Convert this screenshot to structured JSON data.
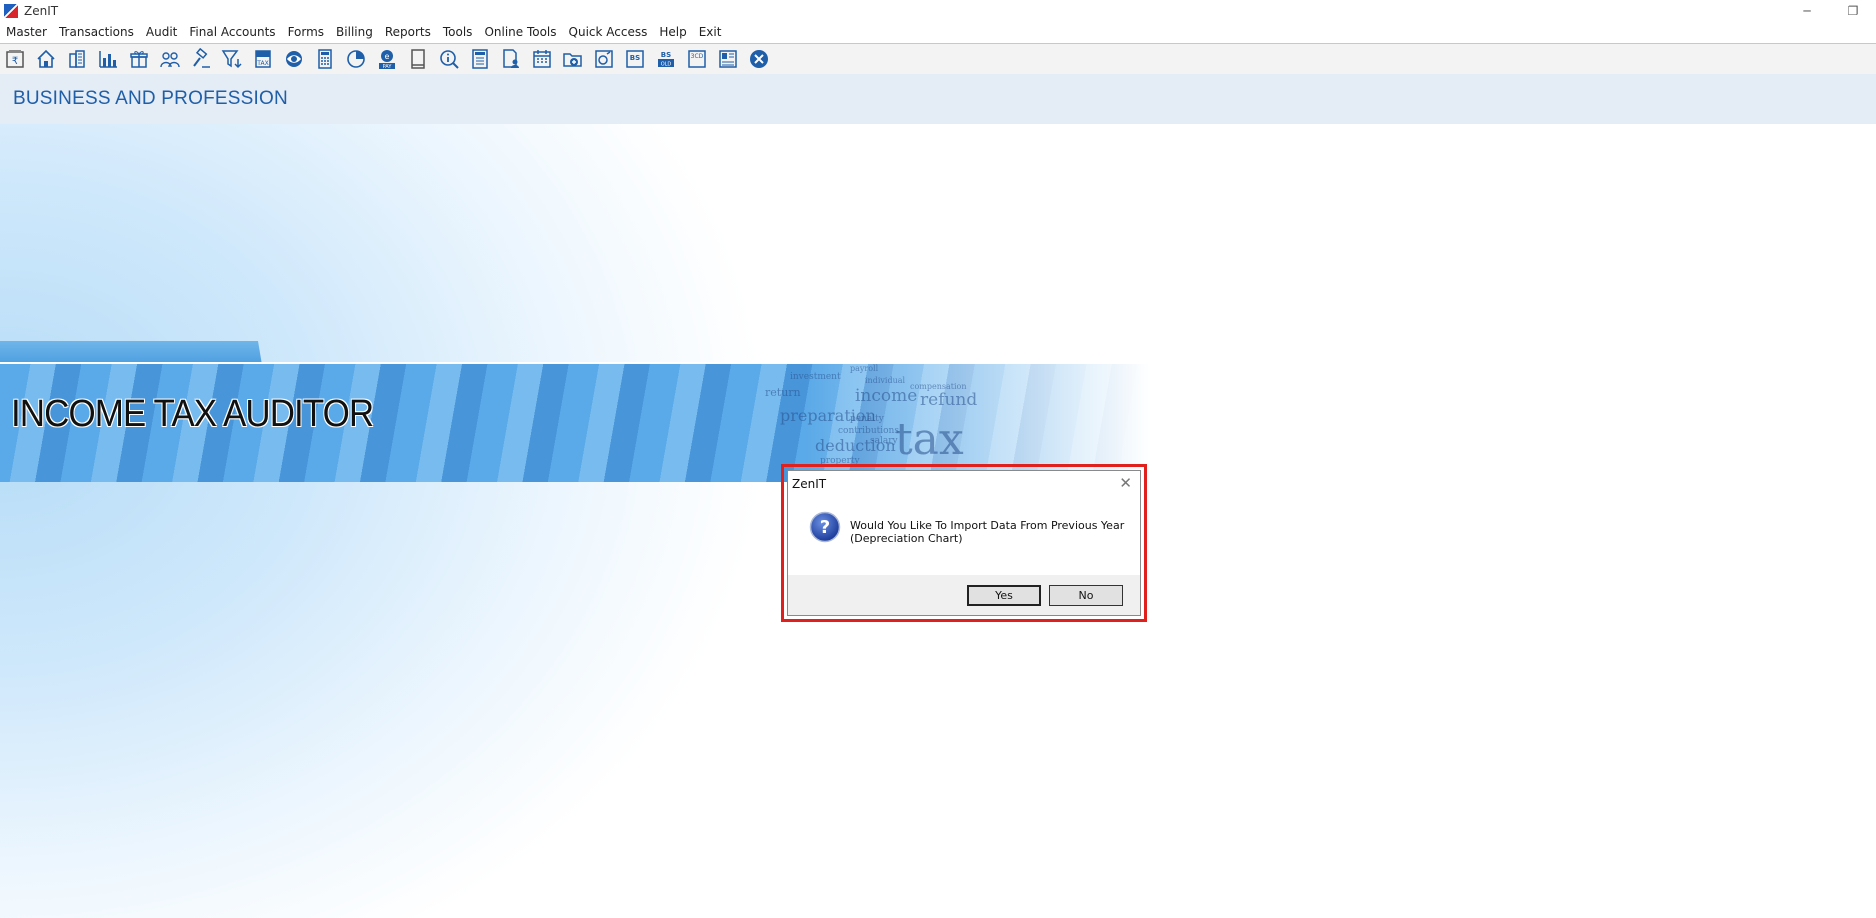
{
  "window": {
    "title": "ZenIT",
    "minimize_glyph": "─",
    "restore_glyph": "❐"
  },
  "menu": {
    "items": [
      "Master",
      "Transactions",
      "Audit",
      "Final Accounts",
      "Forms",
      "Billing",
      "Reports",
      "Tools",
      "Online Tools",
      "Quick Access",
      "Help",
      "Exit"
    ]
  },
  "toolbar": {
    "icons": [
      "rupee-book-icon",
      "home-icon",
      "building-icon",
      "bar-chart-icon",
      "gift-icon",
      "users-icon",
      "gavel-icon",
      "filter-icon",
      "tax-icon",
      "eye-icon",
      "calculator-icon",
      "pie-chart-icon",
      "e-pay-icon",
      "book-icon",
      "info-search-icon",
      "report-icon",
      "document-person-icon",
      "calendar-icon",
      "folder-add-icon",
      "refresh-doc-icon",
      "bs-icon",
      "bs-old-icon",
      "3cd-icon",
      "ledger-icon",
      "close-circle-icon"
    ],
    "labels": {
      "tax": "TAX",
      "pay": "PAY",
      "bs": "BS",
      "bsold": "BS",
      "bsold_sub": "OLD",
      "cd": "3CD",
      "e": "e"
    },
    "accent": "#1f5ea8"
  },
  "section": {
    "title": "BUSINESS AND PROFESSION"
  },
  "banner": {
    "title": "INCOME TAX AUDITOR",
    "words": [
      "payroll",
      "investment",
      "income",
      "refund",
      "preparation",
      "deduction",
      "tax",
      "salary",
      "penalty",
      "compensation",
      "contributions",
      "property",
      "individual",
      "return"
    ]
  },
  "dialog": {
    "title": "ZenIT",
    "close_glyph": "✕",
    "message_line1": "Would You Like To Import Data From Previous Year",
    "message_line2": "(Depreciation Chart)",
    "yes_label": "Yes",
    "no_label": "No",
    "highlight_color": "#e0201c"
  }
}
